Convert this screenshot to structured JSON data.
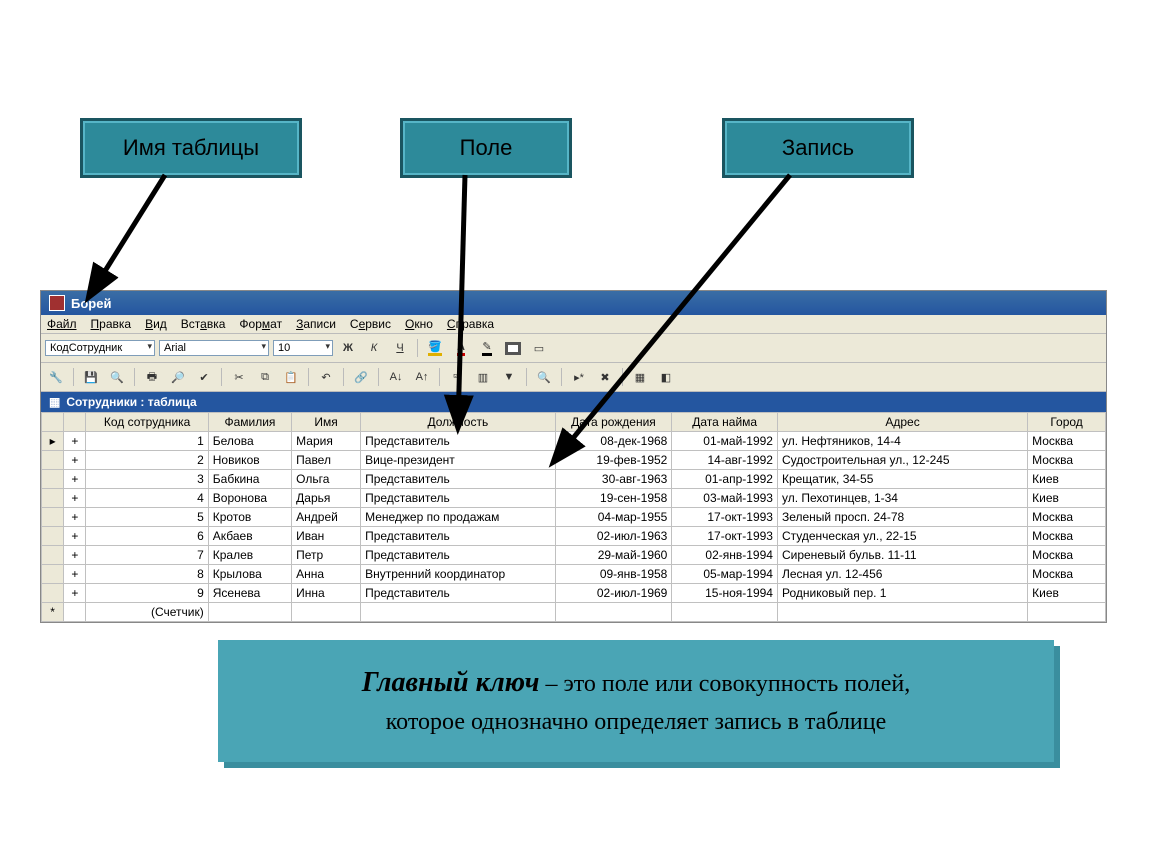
{
  "callouts": {
    "table_name": "Имя таблицы",
    "field": "Поле",
    "record": "Запись"
  },
  "window": {
    "title": "Борей"
  },
  "menu": [
    "Файл",
    "Правка",
    "Вид",
    "Вставка",
    "Формат",
    "Записи",
    "Сервис",
    "Окно",
    "Справка"
  ],
  "format_toolbar": {
    "field_combo": "КодСотрудник",
    "font_combo": "Arial",
    "size_combo": "10",
    "bold": "Ж",
    "italic": "К",
    "underline": "Ч"
  },
  "table_window_title": "Сотрудники : таблица",
  "columns": [
    "Код сотрудника",
    "Фамилия",
    "Имя",
    "Должность",
    "Дата рождения",
    "Дата найма",
    "Адрес",
    "Город"
  ],
  "rows": [
    {
      "id": "1",
      "fam": "Белова",
      "name": "Мария",
      "pos": "Представитель",
      "birth": "08-дек-1968",
      "hire": "01-май-1992",
      "addr": "ул. Нефтяников, 14-4",
      "city": "Москва"
    },
    {
      "id": "2",
      "fam": "Новиков",
      "name": "Павел",
      "pos": "Вице-президент",
      "birth": "19-фев-1952",
      "hire": "14-авг-1992",
      "addr": "Судостроительная ул., 12-245",
      "city": "Москва"
    },
    {
      "id": "3",
      "fam": "Бабкина",
      "name": "Ольга",
      "pos": "Представитель",
      "birth": "30-авг-1963",
      "hire": "01-апр-1992",
      "addr": "Крещатик, 34-55",
      "city": "Киев"
    },
    {
      "id": "4",
      "fam": "Воронова",
      "name": "Дарья",
      "pos": "Представитель",
      "birth": "19-сен-1958",
      "hire": "03-май-1993",
      "addr": "ул. Пехотинцев, 1-34",
      "city": "Киев"
    },
    {
      "id": "5",
      "fam": "Кротов",
      "name": "Андрей",
      "pos": "Менеджер по продажам",
      "birth": "04-мар-1955",
      "hire": "17-окт-1993",
      "addr": "Зеленый просп. 24-78",
      "city": "Москва"
    },
    {
      "id": "6",
      "fam": "Акбаев",
      "name": "Иван",
      "pos": "Представитель",
      "birth": "02-июл-1963",
      "hire": "17-окт-1993",
      "addr": "Студенческая ул., 22-15",
      "city": "Москва"
    },
    {
      "id": "7",
      "fam": "Кралев",
      "name": "Петр",
      "pos": "Представитель",
      "birth": "29-май-1960",
      "hire": "02-янв-1994",
      "addr": "Сиреневый бульв. 11-11",
      "city": "Москва"
    },
    {
      "id": "8",
      "fam": "Крылова",
      "name": "Анна",
      "pos": "Внутренний координатор",
      "birth": "09-янв-1958",
      "hire": "05-мар-1994",
      "addr": "Лесная ул. 12-456",
      "city": "Москва"
    },
    {
      "id": "9",
      "fam": "Ясенева",
      "name": "Инна",
      "pos": "Представитель",
      "birth": "02-июл-1969",
      "hire": "15-ноя-1994",
      "addr": "Родниковый пер. 1",
      "city": "Киев"
    }
  ],
  "new_row_label": "(Счетчик)",
  "definition": {
    "lead": "Главный ключ",
    "rest1": " – это поле или совокупность полей,",
    "rest2": "которое однозначно определяет запись в таблице"
  }
}
